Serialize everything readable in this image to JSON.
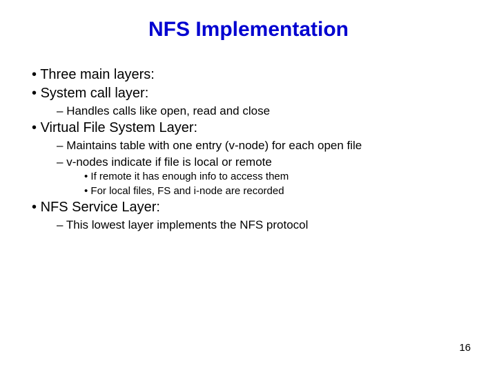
{
  "title": "NFS Implementation",
  "bullets": {
    "b1": "Three main layers:",
    "b2": "System call layer:",
    "b2a": "Handles calls like open, read and close",
    "b3": "Virtual File System Layer:",
    "b3a": "Maintains table with one entry (v-node) for each open file",
    "b3b": "v-nodes indicate if file is local or remote",
    "b3b1": "If remote it has enough info to access them",
    "b3b2": "For local files, FS and i-node are recorded",
    "b4": "NFS Service Layer:",
    "b4a": "This lowest layer implements the NFS protocol"
  },
  "page_number": "16"
}
